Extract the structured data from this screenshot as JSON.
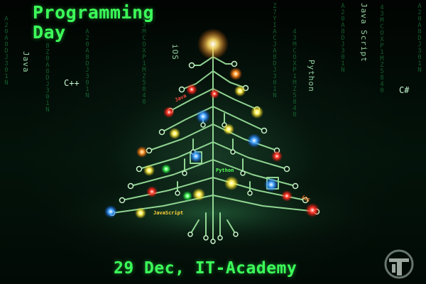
{
  "title": {
    "line1": "Programming",
    "line2": "Day"
  },
  "languages": {
    "java": "Java",
    "cpp": "C++",
    "ios": "iOS",
    "python": "Python",
    "javascript": "Java Script",
    "csharp": "C#"
  },
  "tree_tags": {
    "java": "Java",
    "python": "Python",
    "javascript": "JavaScript",
    "ios": "iOS"
  },
  "matrix_columns": [
    "A20A8DJ301N",
    "8Z0A8DJ301N",
    "43MCOXP1MZ5840",
    "A20A8DJ301N",
    "43MCOXP1MZ5840",
    "A20A8DJ301N",
    "Z7YIACJA8DJ301N",
    "43MCOXP1MZ5840",
    "A20A8DJ301N"
  ],
  "event": {
    "text": "29 Dec, IT-Academy"
  },
  "colors": {
    "title_green": "#3cff5a",
    "matrix_green": "#1f8f45",
    "circuit_green": "#9fe8a0"
  },
  "logo": {
    "icon": "it-academy-logo-icon"
  }
}
